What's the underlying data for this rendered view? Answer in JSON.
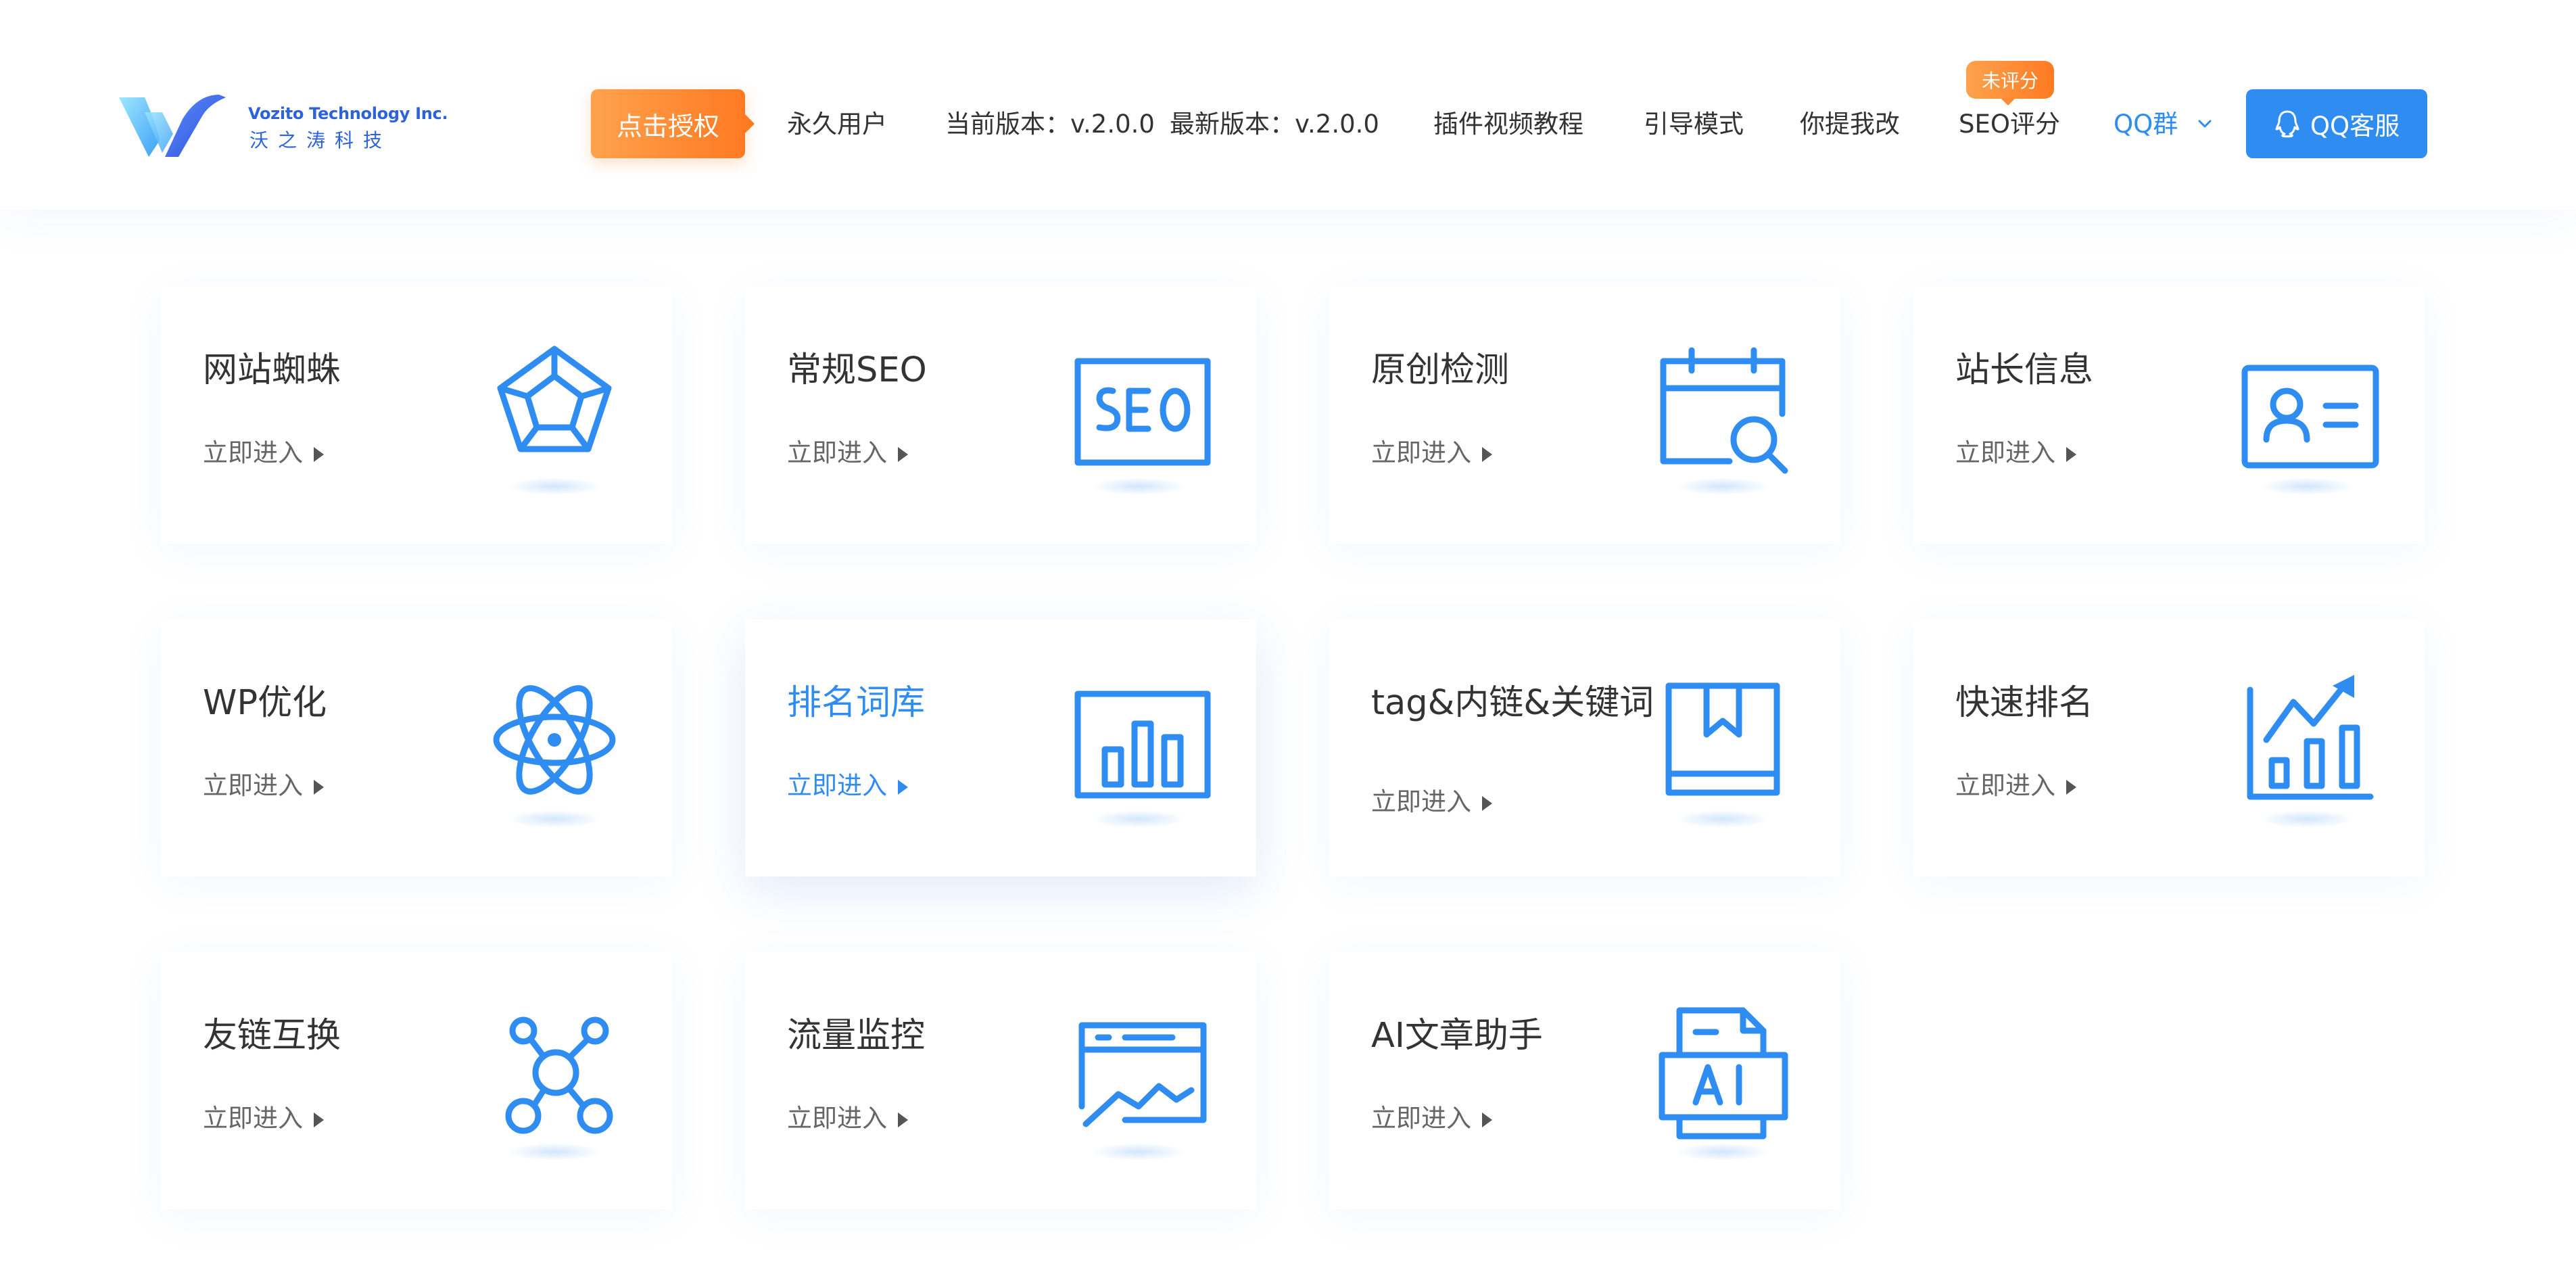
{
  "header": {
    "logo": {
      "name_en": "Vozito Technology Inc.",
      "name_cn": "沃之涛科技"
    },
    "nav": {
      "auth_button": "点击授权",
      "permanent_user": "永久用户",
      "current_version": "当前版本：v.2.0.0",
      "latest_version": "最新版本：v.2.0.0",
      "video_tutorial": "插件视频教程",
      "guide_mode": "引导模式",
      "feedback": "你提我改",
      "seo_score": "SEO评分",
      "seo_score_badge": "未评分",
      "qq_group": "QQ群",
      "qq_service": "QQ客服"
    }
  },
  "cards": [
    {
      "title": "网站蜘蛛",
      "link": "立即进入",
      "icon": "spider-web-icon"
    },
    {
      "title": "常规SEO",
      "link": "立即进入",
      "icon": "seo-icon"
    },
    {
      "title": "原创检测",
      "link": "立即进入",
      "icon": "calendar-search-icon"
    },
    {
      "title": "站长信息",
      "link": "立即进入",
      "icon": "id-card-icon"
    },
    {
      "title": "WP优化",
      "link": "立即进入",
      "icon": "atom-icon"
    },
    {
      "title": "排名词库",
      "link": "立即进入",
      "icon": "bar-chart-icon",
      "active": true
    },
    {
      "title": "tag&内链&关键词",
      "link": "立即进入",
      "icon": "bookmark-book-icon"
    },
    {
      "title": "快速排名",
      "link": "立即进入",
      "icon": "trend-up-chart-icon"
    },
    {
      "title": "友链互换",
      "link": "立即进入",
      "icon": "network-nodes-icon"
    },
    {
      "title": "流量监控",
      "link": "立即进入",
      "icon": "traffic-monitor-icon"
    },
    {
      "title": "AI文章助手",
      "link": "立即进入",
      "icon": "ai-document-icon"
    }
  ],
  "colors": {
    "accent": "#2f8cf0",
    "orange": "#ff7a22",
    "text": "#333333",
    "muted": "#666666"
  }
}
